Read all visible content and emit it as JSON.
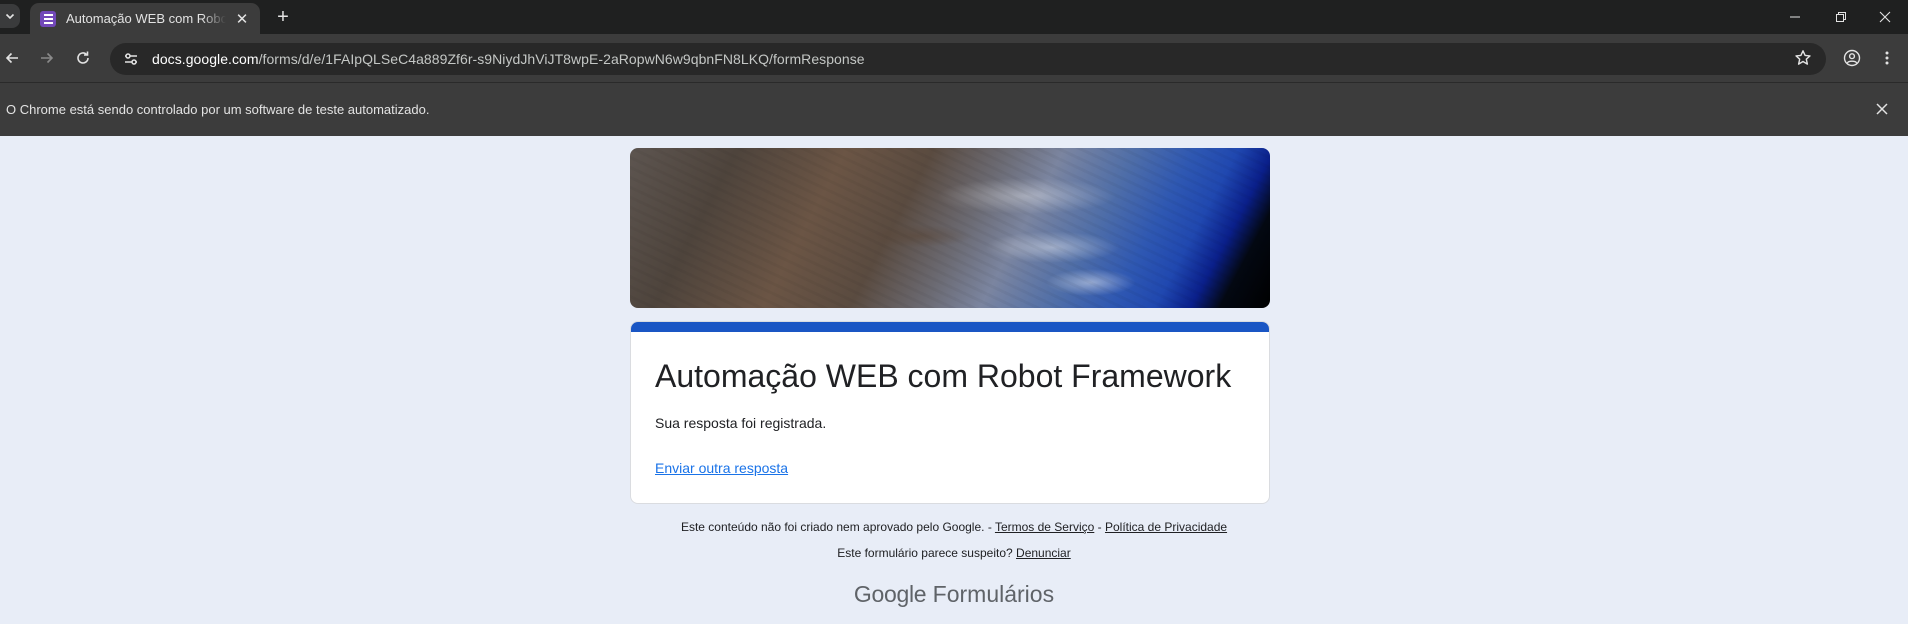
{
  "browser": {
    "tab": {
      "title": "Automação WEB com Robot Framework",
      "favicon": "google-forms-icon"
    },
    "address_bar": {
      "domain": "docs.google.com",
      "path": "/forms/d/e/1FAIpQLSeC4a889Zf6r-s9NiydJhViJT8wpE-2aRopwN6w9qbnFN8LKQ/formResponse"
    },
    "infobar": {
      "message": "O Chrome está sendo controlado por um software de teste automatizado."
    }
  },
  "form": {
    "title": "Automação WEB com Robot Framework",
    "confirmation": "Sua resposta foi registrada.",
    "submit_another": "Enviar outra resposta",
    "accent_color": "#1a56c4"
  },
  "footer": {
    "disclaimer": "Este conteúdo não foi criado nem aprovado pelo Google.",
    "sep1": " - ",
    "terms": "Termos de Serviço",
    "sep2": " - ",
    "privacy": "Política de Privacidade",
    "suspicious": "Este formulário parece suspeito?",
    "report": "Denunciar",
    "brand_google": "Google",
    "brand_product": "Formulários"
  }
}
